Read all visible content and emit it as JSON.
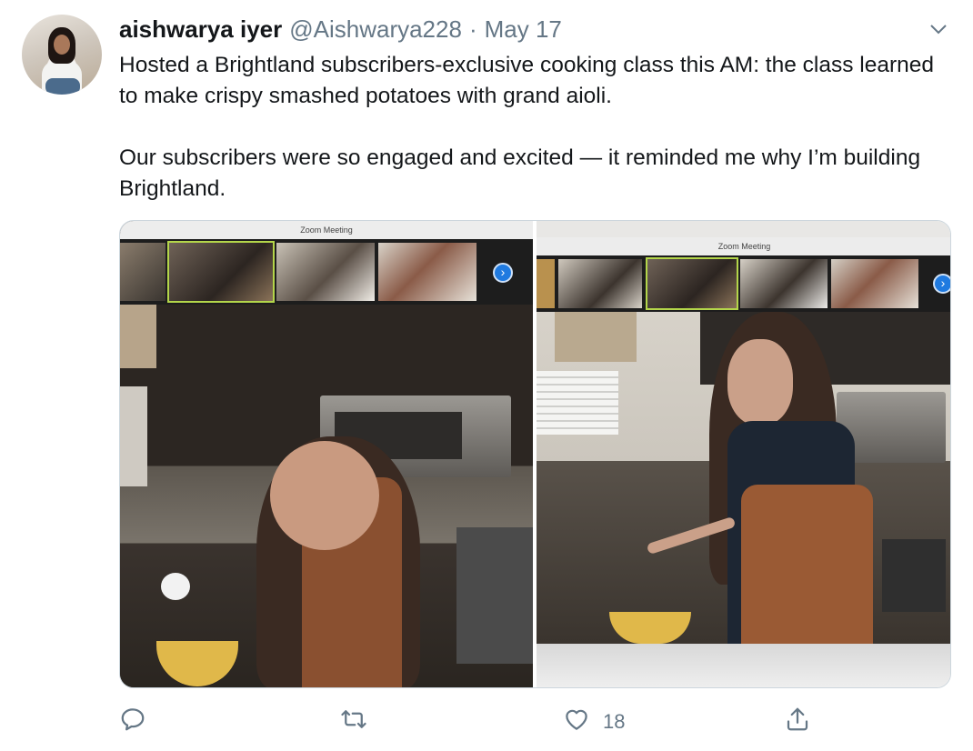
{
  "tweet": {
    "author_name": "aishwarya iyer",
    "handle": "@Aishwarya228",
    "separator": "·",
    "date": "May 17",
    "paragraphs": [
      "Hosted a Brightland subscribers-exclusive cooking class this AM: the class learned to make crispy smashed potatoes with grand aioli.",
      "Our subscribers were so engaged and excited — it reminded me why I’m building Brightland."
    ]
  },
  "media": {
    "left_window_title": "Zoom Meeting",
    "right_window_title": "Zoom Meeting"
  },
  "actions": {
    "reply_count": "",
    "retweet_count": "",
    "like_count": "18"
  },
  "colors": {
    "text_primary": "#14171a",
    "text_secondary": "#657786",
    "border": "#ccd6dd",
    "zoom_active_outline": "#b4d64a",
    "zoom_next_button": "#1f7ae0"
  },
  "icons": [
    "avatar",
    "chevron-down-icon",
    "reply-icon",
    "retweet-icon",
    "like-icon",
    "share-icon",
    "zoom-next-icon"
  ]
}
